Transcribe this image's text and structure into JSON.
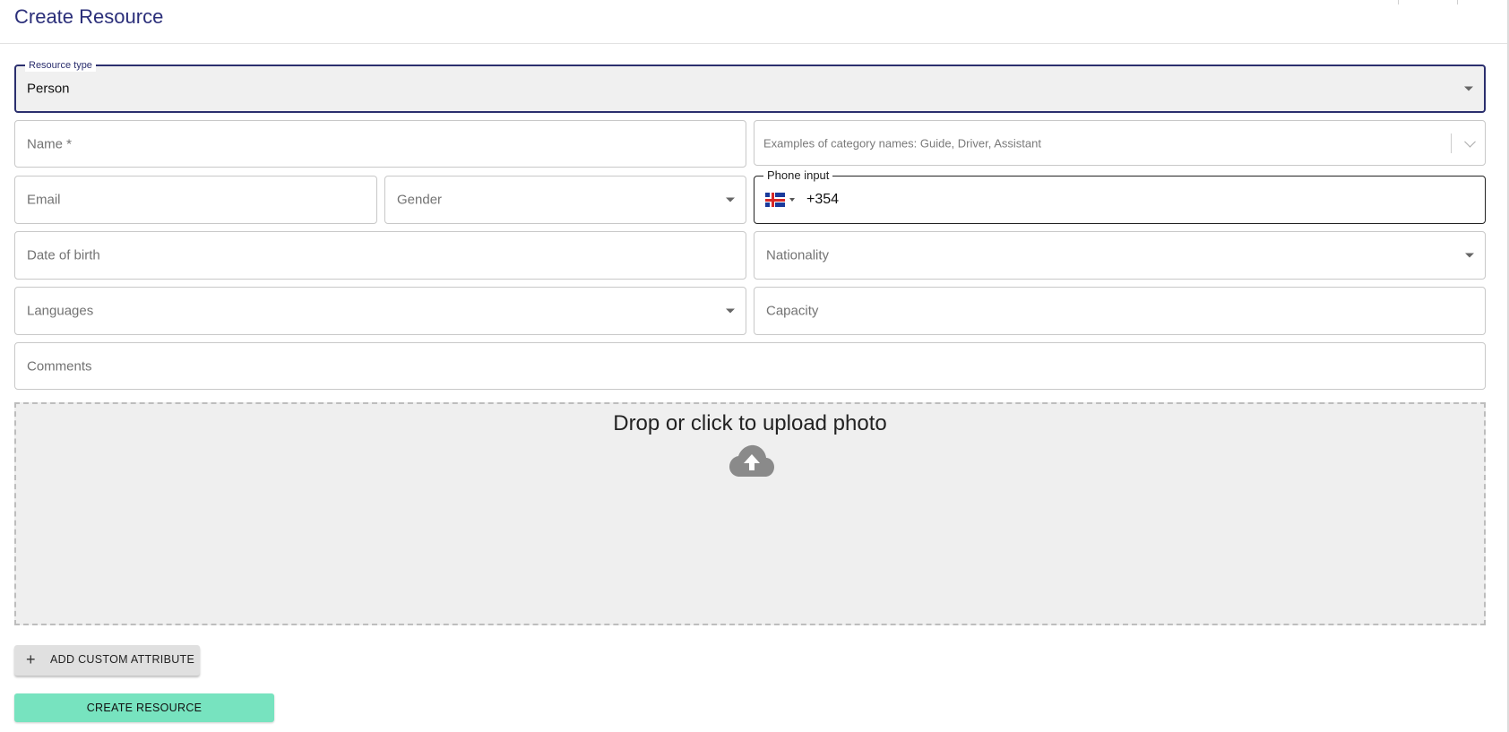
{
  "header": {
    "title": "Create Resource"
  },
  "form": {
    "resource_type": {
      "label": "Resource type",
      "value": "Person"
    },
    "name": {
      "placeholder": "Name *"
    },
    "category": {
      "placeholder": "Examples of category names: Guide, Driver, Assistant"
    },
    "email": {
      "placeholder": "Email"
    },
    "gender": {
      "placeholder": "Gender"
    },
    "phone": {
      "label": "Phone input",
      "value": "+354",
      "country_flag": "iceland-flag-icon"
    },
    "date_of_birth": {
      "placeholder": "Date of birth"
    },
    "nationality": {
      "placeholder": "Nationality"
    },
    "languages": {
      "placeholder": "Languages"
    },
    "capacity": {
      "placeholder": "Capacity"
    },
    "comments": {
      "placeholder": "Comments"
    }
  },
  "upload": {
    "text": "Drop or click to upload photo",
    "icon": "cloud-upload-icon"
  },
  "buttons": {
    "add_custom_attribute": "ADD CUSTOM ATTRIBUTE",
    "add_icon": "plus-icon",
    "create_resource": "CREATE RESOURCE"
  },
  "colors": {
    "title": "#2b2f7a",
    "focus_border": "#2b2f6e",
    "create_button": "#77e3bf"
  }
}
